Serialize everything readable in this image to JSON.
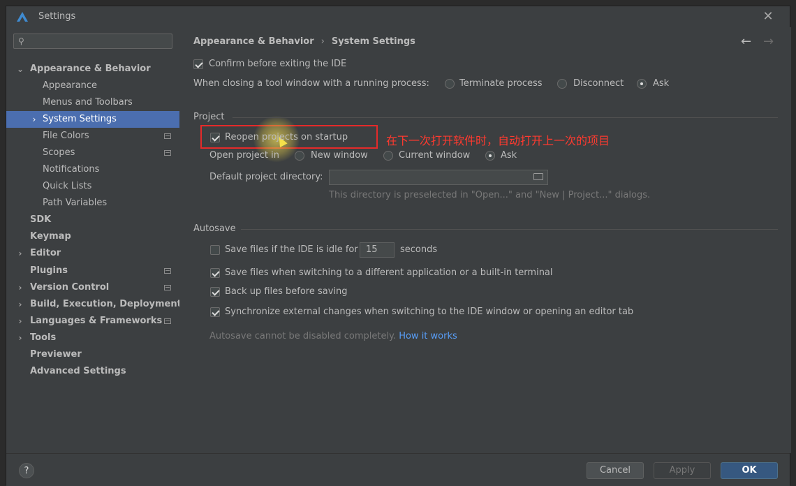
{
  "window": {
    "title": "Settings"
  },
  "search": {
    "placeholder": "",
    "value": ""
  },
  "sidebar": {
    "items": [
      {
        "label": "Appearance & Behavior"
      },
      {
        "label": "Appearance"
      },
      {
        "label": "Menus and Toolbars"
      },
      {
        "label": "System Settings"
      },
      {
        "label": "File Colors"
      },
      {
        "label": "Scopes"
      },
      {
        "label": "Notifications"
      },
      {
        "label": "Quick Lists"
      },
      {
        "label": "Path Variables"
      },
      {
        "label": "SDK"
      },
      {
        "label": "Keymap"
      },
      {
        "label": "Editor"
      },
      {
        "label": "Plugins"
      },
      {
        "label": "Version Control"
      },
      {
        "label": "Build, Execution, Deployment"
      },
      {
        "label": "Languages & Frameworks"
      },
      {
        "label": "Tools"
      },
      {
        "label": "Previewer"
      },
      {
        "label": "Advanced Settings"
      }
    ]
  },
  "breadcrumb": {
    "parent": "Appearance & Behavior",
    "separator": "›",
    "current": "System Settings"
  },
  "general": {
    "confirm_exit": {
      "label": "Confirm before exiting the IDE",
      "checked": true
    },
    "closing_label": "When closing a tool window with a running process:",
    "closing_options": [
      "Terminate process",
      "Disconnect",
      "Ask"
    ],
    "closing_selected": "Ask"
  },
  "project": {
    "section_title": "Project",
    "reopen": {
      "label": "Reopen projects on startup",
      "checked": true
    },
    "open_in_label": "Open project in",
    "open_in_options": [
      "New window",
      "Current window",
      "Ask"
    ],
    "open_in_selected": "Ask",
    "default_dir_label": "Default project directory:",
    "default_dir_value": "",
    "default_dir_hint": "This directory is preselected in \"Open...\" and \"New | Project...\" dialogs."
  },
  "autosave": {
    "section_title": "Autosave",
    "idle": {
      "label": "Save files if the IDE is idle for",
      "value": "15",
      "unit": "seconds",
      "checked": false
    },
    "switch_app": {
      "label": "Save files when switching to a different application or a built-in terminal",
      "checked": true
    },
    "backup": {
      "label": "Back up files before saving",
      "checked": true
    },
    "sync": {
      "label": "Synchronize external changes when switching to the IDE window or opening an editor tab",
      "checked": true
    },
    "hint": "Autosave cannot be disabled completely.",
    "hint_link": "How it works"
  },
  "annotation": {
    "text": "在下一次打开软件时，自动打开上一次的项目",
    "color": "#e52a2a"
  },
  "footer": {
    "help": "?",
    "cancel": "Cancel",
    "apply": "Apply",
    "ok": "OK"
  },
  "colors": {
    "accent": "#4b6eaf",
    "primary_button": "#365880",
    "link": "#589df6"
  }
}
